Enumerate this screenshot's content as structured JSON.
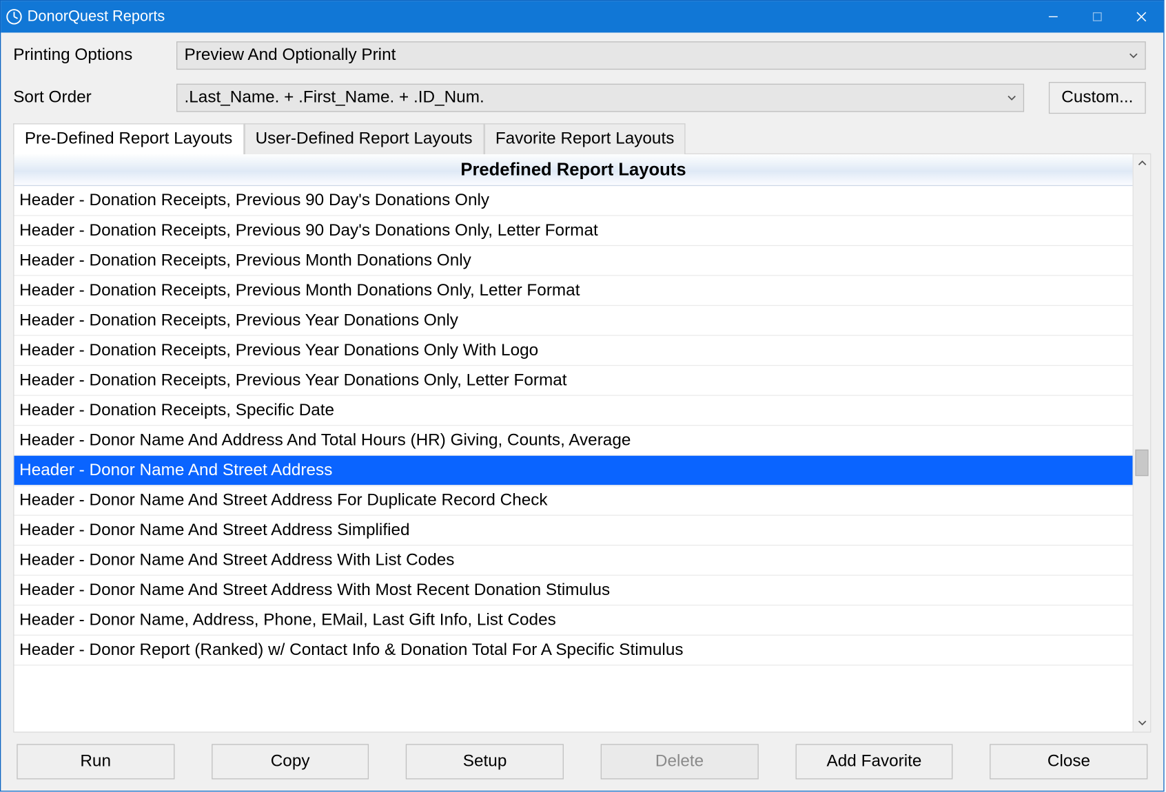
{
  "window": {
    "title": "DonorQuest Reports"
  },
  "form": {
    "printing_label": "Printing Options",
    "printing_value": "Preview And Optionally Print",
    "sort_label": "Sort Order",
    "sort_value": ".Last_Name. + .First_Name. + .ID_Num.",
    "custom_button": "Custom..."
  },
  "tabs": {
    "items": [
      "Pre-Defined Report Layouts",
      "User-Defined Report Layouts",
      "Favorite Report Layouts"
    ],
    "active_index": 0
  },
  "list": {
    "header": "Predefined Report Layouts",
    "selected_index": 9,
    "rows": [
      "Header - Donation Receipts, Previous 90 Day's Donations Only",
      "Header - Donation Receipts, Previous 90 Day's Donations Only, Letter Format",
      "Header - Donation Receipts, Previous Month Donations Only",
      "Header - Donation Receipts, Previous Month Donations Only, Letter Format",
      "Header - Donation Receipts, Previous Year Donations Only",
      "Header - Donation Receipts, Previous Year Donations Only With Logo",
      "Header - Donation Receipts, Previous Year Donations Only, Letter Format",
      "Header - Donation Receipts, Specific Date",
      "Header - Donor Name And Address And Total Hours (HR) Giving, Counts, Average",
      "Header - Donor Name And Street Address",
      "Header - Donor Name And Street Address For Duplicate Record Check",
      "Header - Donor Name And Street Address Simplified",
      "Header - Donor Name And Street Address With List Codes",
      "Header - Donor Name And Street Address With Most Recent Donation Stimulus",
      "Header - Donor Name, Address, Phone, EMail, Last Gift Info, List Codes",
      "Header - Donor Report (Ranked) w/ Contact Info & Donation Total For A Specific Stimulus"
    ]
  },
  "buttons": {
    "run": "Run",
    "copy": "Copy",
    "setup": "Setup",
    "delete": "Delete",
    "add_favorite": "Add Favorite",
    "close": "Close"
  }
}
